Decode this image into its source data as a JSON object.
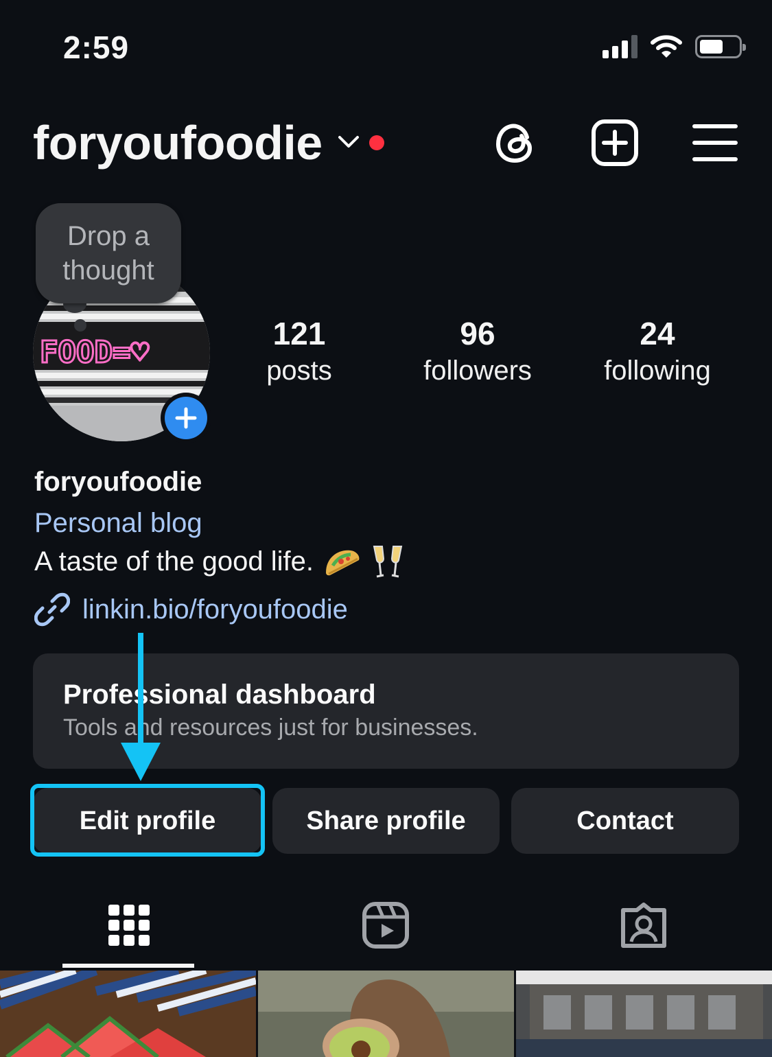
{
  "status_bar": {
    "time": "2:59",
    "icons": [
      "signal-icon",
      "wifi-icon",
      "battery-icon"
    ]
  },
  "header": {
    "username": "foryoufoodie",
    "icons": [
      "chevron-down-icon",
      "threads-icon",
      "add-content-icon",
      "hamburger-menu-icon"
    ],
    "notification_dot_color": "#ff3040"
  },
  "note": {
    "line1": "Drop a",
    "line2": "thought"
  },
  "avatar": {
    "sign_text": "FOOD=♡"
  },
  "stats": [
    {
      "value": "121",
      "label": "posts"
    },
    {
      "value": "96",
      "label": "followers"
    },
    {
      "value": "24",
      "label": "following"
    }
  ],
  "bio": {
    "name": "foryoufoodie",
    "category": "Personal blog",
    "text": "A taste of the good life.",
    "emojis": [
      "taco",
      "clinking-glasses"
    ],
    "link": "linkin.bio/foryoufoodie"
  },
  "dashboard": {
    "title": "Professional dashboard",
    "subtitle": "Tools and resources just for businesses."
  },
  "buttons": {
    "edit": "Edit profile",
    "share": "Share profile",
    "contact": "Contact"
  },
  "tabs": [
    "grid-icon",
    "reels-icon",
    "tagged-icon"
  ],
  "colors": {
    "background": "#0c0f14",
    "link": "#a8c7f5",
    "highlight": "#14c3f5",
    "add_badge": "#2f8cf0"
  }
}
